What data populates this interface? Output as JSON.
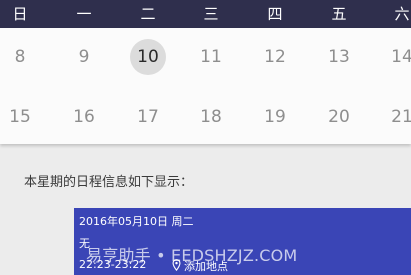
{
  "weekdays": [
    "日",
    "一",
    "二",
    "三",
    "四",
    "五",
    "六"
  ],
  "week1": [
    "8",
    "9",
    "10",
    "11",
    "12",
    "13",
    "14"
  ],
  "week2": [
    "15",
    "16",
    "17",
    "18",
    "19",
    "20",
    "21"
  ],
  "selected_day": "10",
  "section_label": "本星期的日程信息如下显示：",
  "event": {
    "date": "2016年05月10日 周二",
    "title": "无",
    "time": "22:23-23:22",
    "location_action": "添加地点"
  },
  "watermark": "易亨助手 • EEDSHZJZ.COM",
  "colors": {
    "header_bg": "#2f2f4d",
    "card_bg": "#3a45b6",
    "selected_circle": "#dcdcdc"
  },
  "icons": {
    "location": "location-pin-icon"
  }
}
